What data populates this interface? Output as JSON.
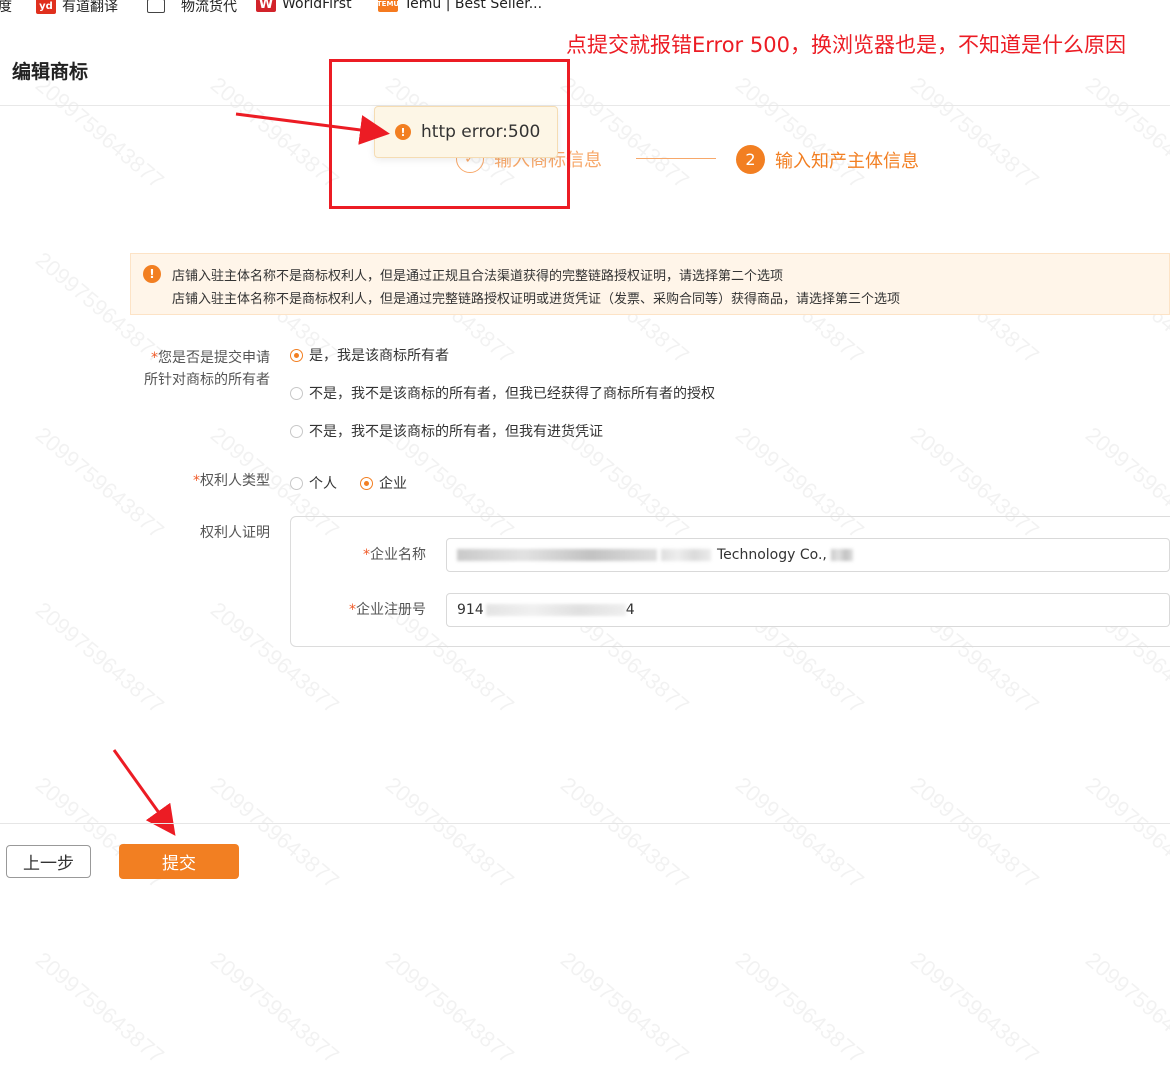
{
  "bookmarks": [
    {
      "label": "度",
      "icon": "none"
    },
    {
      "label": "有道翻译",
      "icon": "youdao-icon",
      "icon_text": "yd"
    },
    {
      "label": "物流货代",
      "icon": "folder-icon"
    },
    {
      "label": "WorldFirst",
      "icon": "worldfirst-icon",
      "icon_text": "W"
    },
    {
      "label": "Temu | Best Seller...",
      "icon": "temu-icon",
      "icon_text": "TEMU"
    }
  ],
  "page": {
    "title": "编辑商标"
  },
  "steps": [
    {
      "number": "1",
      "label": "输入商标信息",
      "state": "done"
    },
    {
      "number": "2",
      "label": "输入知产主体信息",
      "state": "active"
    }
  ],
  "toast": {
    "message": "http error:500",
    "icon": "warning-icon"
  },
  "annotation": {
    "text": "点提交就报错Error 500，换浏览器也是，不知道是什么原因",
    "color": "#ec1c24"
  },
  "notice": {
    "icon": "warning-icon",
    "lines": [
      "店铺入驻主体名称不是商标权利人，但是通过正规且合法渠道获得的完整链路授权证明，请选择第二个选项",
      "店铺入驻主体名称不是商标权利人，但是通过完整链路授权证明或进货凭证（发票、采购合同等）获得商品，请选择第三个选项"
    ]
  },
  "form": {
    "owner_question": {
      "required_mark": "*",
      "label_line1": "您是否是提交申请",
      "label_line2": "所针对商标的所有者",
      "options": [
        {
          "label": "是，我是该商标所有者",
          "selected": true
        },
        {
          "label": "不是，我不是该商标的所有者，但我已经获得了商标所有者的授权",
          "selected": false
        },
        {
          "label": "不是，我不是该商标的所有者，但我有进货凭证",
          "selected": false
        }
      ]
    },
    "holder_type": {
      "required_mark": "*",
      "label": "权利人类型",
      "options": [
        {
          "label": "个人",
          "selected": false
        },
        {
          "label": "企业",
          "selected": true
        }
      ]
    },
    "holder_proof": {
      "label": "权利人证明",
      "company_name": {
        "required_mark": "*",
        "label": "企业名称",
        "value_visible": "Technology Co.,"
      },
      "registration_no": {
        "required_mark": "*",
        "label": "企业注册号",
        "value_prefix": "914",
        "value_suffix": "4"
      }
    }
  },
  "footer": {
    "prev_label": "上一步",
    "submit_label": "提交"
  },
  "watermark": "2099759643877",
  "colors": {
    "accent": "#f27f22",
    "annotation_red": "#ec1c24",
    "notice_bg": "#fff5e9"
  }
}
